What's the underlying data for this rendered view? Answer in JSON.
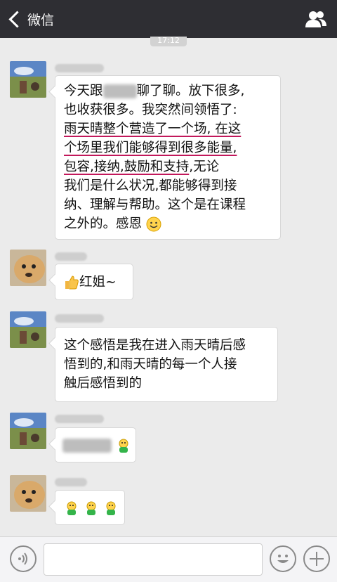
{
  "header": {
    "back_label": "微信",
    "back_icon": "chevron-left-icon",
    "contacts_icon": "people-icon",
    "time": "17:12"
  },
  "messages": [
    {
      "lines": [
        [
          "今天跟",
          "BLUR",
          "聊了聊。放下很多,"
        ],
        [
          "也收获很多。我突然间领悟了:"
        ],
        [
          "雨天晴整个营造了一个场, 在这"
        ],
        [
          "个场里我们能够得到很多能量,"
        ],
        [
          "包容,接纳,鼓励和支持",
          ",无论"
        ],
        [
          "我们是什么状况,都能够得到接"
        ],
        [
          "纳、理解与帮助。这个是在课程"
        ],
        [
          "之外的。感恩",
          "SMILE"
        ]
      ]
    },
    {
      "text": "红姐~"
    },
    {
      "lines": [
        [
          "这个感悟是我在进入雨天晴后感"
        ],
        [
          "悟到的,和雨天晴的每一个人接"
        ],
        [
          "触后感悟到的"
        ]
      ]
    }
  ],
  "emoji_names": [
    "thumbs-up-icon",
    "smile-icon",
    "green-person-icon"
  ],
  "bottom": {
    "voice_icon": "voice-icon",
    "emoji_icon": "emoji-icon",
    "plus_icon": "plus-icon"
  },
  "colors": {
    "topbar": "#2e2e33",
    "background": "#ebebeb",
    "underline": "#c2185b"
  }
}
